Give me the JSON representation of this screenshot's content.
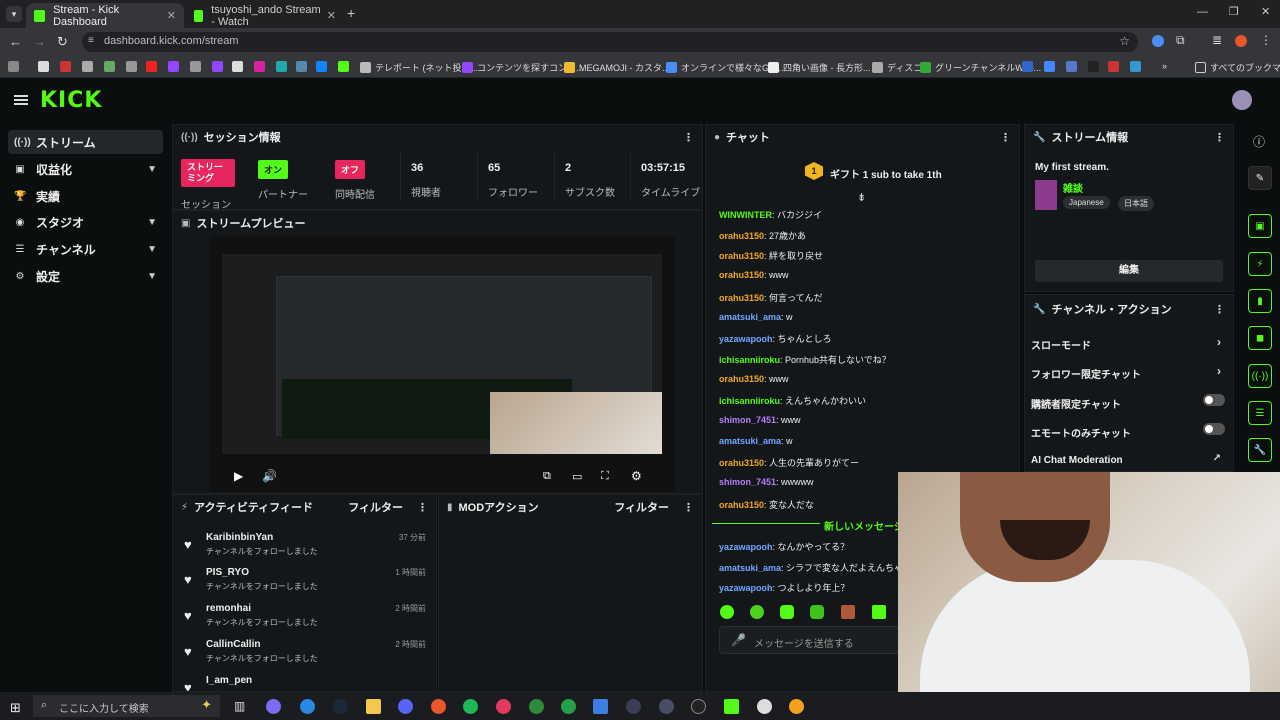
{
  "browser": {
    "tabs": [
      {
        "label": "Stream - Kick Dashboard"
      },
      {
        "label": "tsuyoshi_ando Stream - Watch"
      }
    ],
    "url": "dashboard.kick.com/stream",
    "bookmarks": [
      "テレポート (ネット投資...",
      "コンテンツを探すコンテ...",
      "MEGAMOJI - カスタ...",
      "オンラインで様々なGIF...",
      "四角い画像 - 長方形...",
      "ディスコ",
      "グリーンチャンネルWeb...",
      "すべてのブックマーク"
    ]
  },
  "brand": {
    "logo": "KICK",
    "accent": "#53fc18"
  },
  "sidebar": {
    "items": [
      {
        "label": "ストリーム",
        "icon": "broadcast-icon",
        "chevron": false
      },
      {
        "label": "収益化",
        "icon": "money-icon",
        "chevron": true
      },
      {
        "label": "実績",
        "icon": "trophy-icon",
        "chevron": false
      },
      {
        "label": "スタジオ",
        "icon": "studio-icon",
        "chevron": true
      },
      {
        "label": "チャンネル",
        "icon": "channel-icon",
        "chevron": true
      },
      {
        "label": "設定",
        "icon": "gear-icon",
        "chevron": true
      }
    ]
  },
  "session": {
    "title": "セッション情報",
    "streaming_badge": "ストリーミング",
    "streaming_label": "セッション",
    "partner_badge": "オン",
    "partner_label": "パートナー",
    "multistream_badge": "オフ",
    "multistream_label": "同時配信",
    "viewers": "36",
    "viewers_label": "視聴者",
    "followers": "65",
    "followers_label": "フォロワー",
    "subs": "2",
    "subs_label": "サブスク数",
    "uptime": "03:57:15",
    "uptime_label": "タイムライブ"
  },
  "preview": {
    "title": "ストリームプレビュー"
  },
  "activity": {
    "title": "アクティビティフィード",
    "filter": "フィルター",
    "items": [
      {
        "name": "KaribinbinYan",
        "desc": "チャンネルをフォローしました",
        "time": "37 分前"
      },
      {
        "name": "PIS_RYO",
        "desc": "チャンネルをフォローしました",
        "time": "1 時間前"
      },
      {
        "name": "remonhai",
        "desc": "チャンネルをフォローしました",
        "time": "2 時間前"
      },
      {
        "name": "CallinCallin",
        "desc": "チャンネルをフォローしました",
        "time": "2 時間前"
      },
      {
        "name": "I_am_pen",
        "desc": "",
        "time": ""
      }
    ]
  },
  "mod": {
    "title": "MODアクション",
    "filter": "フィルター"
  },
  "chat": {
    "title": "チャット",
    "gift": "ギフト 1 sub to take 1th",
    "messages": [
      {
        "user": "WINWINTER",
        "color": "#53fc18",
        "text": ": バカジジイ"
      },
      {
        "user": "orahu3150",
        "color": "#f5a623",
        "text": ": 27歳かあ"
      },
      {
        "user": "orahu3150",
        "color": "#f5a623",
        "text": ": 絆を取り戻せ"
      },
      {
        "user": "orahu3150",
        "color": "#f5a623",
        "text": ": www"
      },
      {
        "user": "orahu3150",
        "color": "#f5a623",
        "text": ": 何言ってんだ"
      },
      {
        "user": "amatsuki_ama",
        "color": "#6fa8ff",
        "text": ": w"
      },
      {
        "user": "yazawapooh",
        "color": "#6fa8ff",
        "text": ": ちゃんとしろ"
      },
      {
        "user": "ichisanniiroku",
        "color": "#53fc18",
        "text": ": Pornhub共有しないでね？"
      },
      {
        "user": "orahu3150",
        "color": "#f5a623",
        "text": ": www"
      },
      {
        "user": "ichisanniiroku",
        "color": "#53fc18",
        "text": ": えんちゃんかわいい"
      },
      {
        "user": "shimon_7451",
        "color": "#b57cff",
        "text": ": www"
      },
      {
        "user": "amatsuki_ama",
        "color": "#6fa8ff",
        "text": ": w"
      },
      {
        "user": "orahu3150",
        "color": "#f5a623",
        "text": ": 人生の先輩ありがてー"
      },
      {
        "user": "shimon_7451",
        "color": "#b57cff",
        "text": ": wwwww"
      },
      {
        "user": "orahu3150",
        "color": "#f5a623",
        "text": ": 変な人だな"
      }
    ],
    "new_messages": "新しいメッセージ",
    "new": [
      {
        "user": "yazawapooh",
        "color": "#6fa8ff",
        "text": ": なんかやってる？"
      },
      {
        "user": "amatsuki_ama",
        "color": "#6fa8ff",
        "text": ": シラフで変な人だよえんちゃ"
      },
      {
        "user": "yazawapooh",
        "color": "#6fa8ff",
        "text": ": つよしより年上？"
      }
    ],
    "placeholder": "メッセージを送信する"
  },
  "stream_info": {
    "title": "ストリーム情報",
    "stream_title": "My first stream.",
    "category": "雑談",
    "tags": [
      "Japanese",
      "日本語"
    ],
    "edit": "編集"
  },
  "channel_actions": {
    "title": "チャンネル・アクション",
    "items": [
      {
        "label": "スローモード",
        "control": "arrow"
      },
      {
        "label": "フォロワー限定チャット",
        "control": "arrow"
      },
      {
        "label": "購読者限定チャット",
        "control": "toggle"
      },
      {
        "label": "エモートのみチャット",
        "control": "toggle"
      },
      {
        "label": "AI Chat Moderation",
        "control": "link"
      }
    ]
  },
  "taskbar": {
    "search": "ここに入力して検索"
  }
}
